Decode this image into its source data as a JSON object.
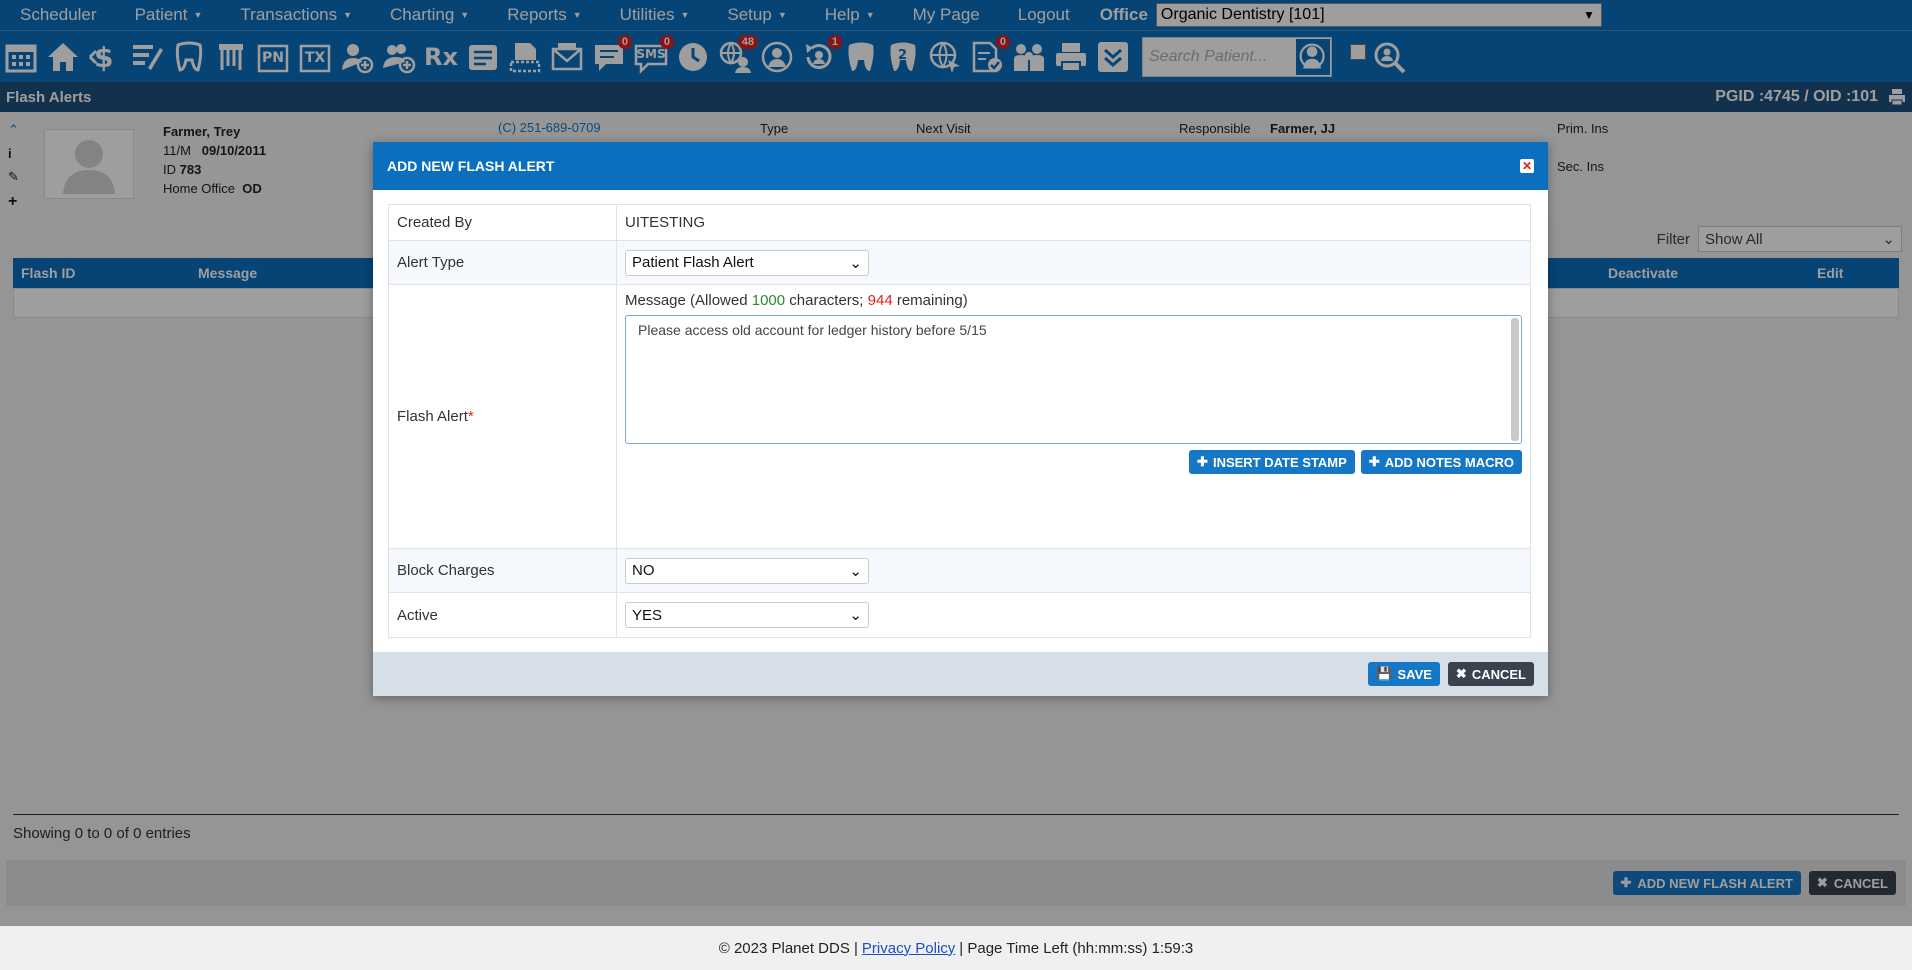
{
  "nav": {
    "items": [
      {
        "label": "Scheduler",
        "caret": false
      },
      {
        "label": "Patient",
        "caret": true
      },
      {
        "label": "Transactions",
        "caret": true
      },
      {
        "label": "Charting",
        "caret": true
      },
      {
        "label": "Reports",
        "caret": true
      },
      {
        "label": "Utilities",
        "caret": true
      },
      {
        "label": "Setup",
        "caret": true
      },
      {
        "label": "Help",
        "caret": true
      },
      {
        "label": "My Page",
        "caret": false
      },
      {
        "label": "Logout",
        "caret": false
      }
    ],
    "office_label": "Office",
    "office_value": "Organic Dentistry [101]"
  },
  "toolbar": {
    "icons": [
      "calendar-icon",
      "home-icon",
      "dollar-icon",
      "notes-edit-icon",
      "tooth-chart-icon",
      "perio-icon",
      "pn-icon",
      "tx-icon",
      "add-patient-icon",
      "family-add-icon",
      "rx-icon",
      "documents-icon",
      "scan-icon",
      "email-icon",
      "messages-icon",
      "sms-icon",
      "clock-icon",
      "online-users-icon",
      "globe-people-icon",
      "recall-icon",
      "tooth-icon",
      "tooth-two-icon",
      "web-cursor-icon",
      "forms-check-icon",
      "family-icon",
      "print-icon",
      "collapse-icon"
    ],
    "pn_text": "PN",
    "tx_text": "TX",
    "rx_text": "Rx",
    "sms_text": "SMS",
    "badges": {
      "messages": "0",
      "sms": "0",
      "online": "48",
      "recall": "1",
      "forms": "0"
    },
    "search_placeholder": "Search Patient..."
  },
  "page": {
    "title": "Flash Alerts",
    "pgid": "PGID :4745  /  OID :101"
  },
  "patient": {
    "name": "Farmer, Trey",
    "sex_age": "11/M",
    "dob": "09/10/2011",
    "id_label": "ID",
    "id_value": "783",
    "home_office_label": "Home Office",
    "home_office_value": "OD",
    "phone": "(C)   251-689-0709",
    "type_label": "Type",
    "next_visit_label": "Next Visit",
    "responsible_label": "Responsible",
    "responsible_value": "Farmer, JJ",
    "prim_ins_label": "Prim. Ins",
    "sec_ins_label": "Sec. Ins"
  },
  "table": {
    "filter_label": "Filter",
    "filter_value": "Show All",
    "columns": {
      "flash_id": "Flash ID",
      "message": "Message",
      "deactivate": "Deactivate",
      "edit": "Edit"
    },
    "entries_text": "Showing 0 to 0 of 0 entries",
    "add_button": "ADD NEW FLASH ALERT",
    "cancel_button": "CANCEL"
  },
  "modal": {
    "title": "ADD NEW FLASH ALERT",
    "created_by_label": "Created By",
    "created_by_value": "UITESTING",
    "alert_type_label": "Alert Type",
    "alert_type_value": "Patient Flash Alert",
    "flash_alert_label": "Flash Alert",
    "required_mark": "*",
    "message_prefix": "Message (Allowed ",
    "allowed_count": "1000",
    "message_middle": " characters; ",
    "remaining_count": "944",
    "message_suffix": " remaining)",
    "message_text": "Please access old account for ledger history before 5/15",
    "insert_date_button": "INSERT DATE STAMP",
    "add_macro_button": "ADD NOTES MACRO",
    "block_charges_label": "Block Charges",
    "block_charges_value": "NO",
    "active_label": "Active",
    "active_value": "YES",
    "save_button": "SAVE",
    "cancel_button": "CANCEL"
  },
  "footer": {
    "copyright": "© 2023 Planet DDS |",
    "privacy": "Privacy Policy",
    "time_left": "|  Page Time Left (hh:mm:ss) 1:59:3"
  },
  "colors": {
    "brand_blue": "#0b6fbf",
    "title_bar": "#1d4f7d",
    "badge_red": "#e02020",
    "allowed_green": "#2e8b2e",
    "remaining_red": "#e02020"
  }
}
